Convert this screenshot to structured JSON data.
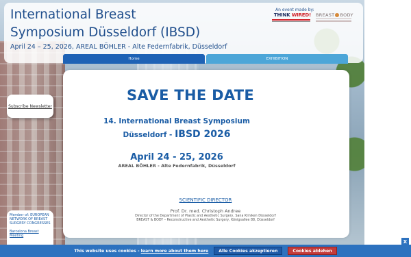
{
  "header": {
    "title_line1": "International Breast",
    "title_line2": "Symposium Düsseldorf (IBSD)",
    "subtitle": "April 24 – 25, 2026, AREAL BÖHLER - Alte Federnfabrik, Düsseldorf",
    "event_by": "An event made by:",
    "logo_think": "THINK ",
    "logo_wired": "WIRED!",
    "logo_breast": "BREAST",
    "logo_body": "BODY"
  },
  "nav": {
    "home": "Home",
    "exhibition": "EXHIBITION"
  },
  "main": {
    "save_the_date": "SAVE THE DATE",
    "symposium_line1": "14. International Breast Symposium",
    "symposium_line2_prefix": "Düsseldorf - ",
    "symposium_line2_big": "IBSD 2026",
    "date": "April 24 - 25, 2026",
    "venue": "AREAL BÖHLER - Alte Federnfabrik, Düsseldorf",
    "scientific_director": "SCIENTIFIC DIRECTOR",
    "director_name": "Prof. Dr. med. Christoph Andree",
    "director_line1": "Director of the Department of Plastic and Aesthetic Surgery, Sana Kliniken Düsseldorf",
    "director_line2": "BREAST & BODY – Reconstructive and Aesthetic Surgery, Königsallee 88, Düsseldorf"
  },
  "sidebar": {
    "newsletter": "Subscribe Newsletter",
    "member": "Member of: EUROPEAN NETWORK OF BREAST SURGERY CONGRESSES",
    "member_link": "Barcelona Breast Meeting"
  },
  "cookie": {
    "text": "This website uses cookies - ",
    "link": "learn more about them here",
    "accept": "Alle Cookies akzeptieren",
    "decline": "Cookies ablehen",
    "close": "X"
  },
  "colors": {
    "brand_blue": "#1a5ca5",
    "nav_home": "#1e62b5",
    "nav_exhibition": "#4ca6d8",
    "cookie_bar": "#2d72bf",
    "decline_red": "#c43b3b"
  }
}
